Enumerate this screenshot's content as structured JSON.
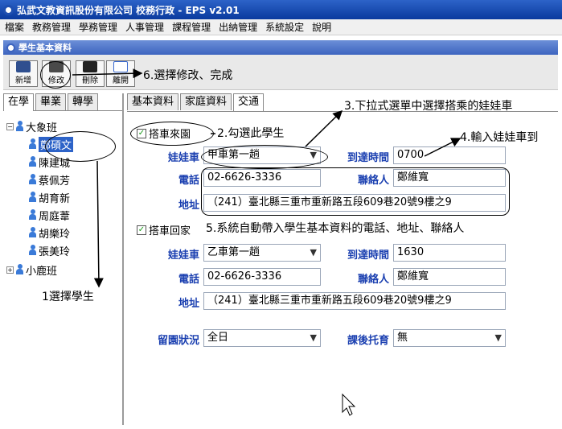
{
  "window": {
    "title": "弘武文教資訊股份有限公司 校務行政 - EPS v2.01",
    "subtitle": "學生基本資料"
  },
  "menu": [
    "檔案",
    "教務管理",
    "學務管理",
    "人事管理",
    "課程管理",
    "出納管理",
    "系統設定",
    "說明"
  ],
  "toolbar": {
    "add_label": "新增",
    "edit_label": "修改",
    "delete_label": "刪除",
    "exit_label": "離開"
  },
  "left_tabs": [
    "在學",
    "畢業",
    "轉學"
  ],
  "tree": {
    "class1": "大象班",
    "students": [
      "鄭碩文",
      "陳建城",
      "蔡佩芳",
      "胡育新",
      "周庭葦",
      "胡樂玲",
      "張美玲"
    ],
    "class2": "小鹿班"
  },
  "right_tabs": [
    "基本資料",
    "家庭資料",
    "交通"
  ],
  "pickup": {
    "checkbox_label": "搭車來園",
    "bus_label": "娃娃車",
    "bus_value": "甲車第一趟",
    "time_label": "到達時間",
    "time_value": "0700",
    "phone_label": "電話",
    "phone_value": "02-6626-3336",
    "contact_label": "聯絡人",
    "contact_value": "鄭維寬",
    "address_label": "地址",
    "address_value": "（241）臺北縣三重市重新路五段609巷20號9樓之9"
  },
  "dropoff": {
    "checkbox_label": "搭車回家",
    "bus_label": "娃娃車",
    "bus_value": "乙車第一趟",
    "time_label": "到達時間",
    "time_value": "1630",
    "phone_label": "電話",
    "phone_value": "02-6626-3336",
    "contact_label": "聯絡人",
    "contact_value": "鄭維寬",
    "address_label": "地址",
    "address_value": "（241）臺北縣三重市重新路五段609巷20號9樓之9"
  },
  "stay": {
    "label": "留園狀況",
    "value": "全日",
    "after_label": "課後托育",
    "after_value": "無"
  },
  "annotations": {
    "a1": "1選擇學生",
    "a2": "2.勾選此學生",
    "a3": "3.下拉式選單中選擇搭乘的娃娃車",
    "a4": "4.輸入娃娃車到",
    "a5": "5.系統自動帶入學生基本資料的電話、地址、聯絡人",
    "a6": "6.選擇修改、完成"
  }
}
